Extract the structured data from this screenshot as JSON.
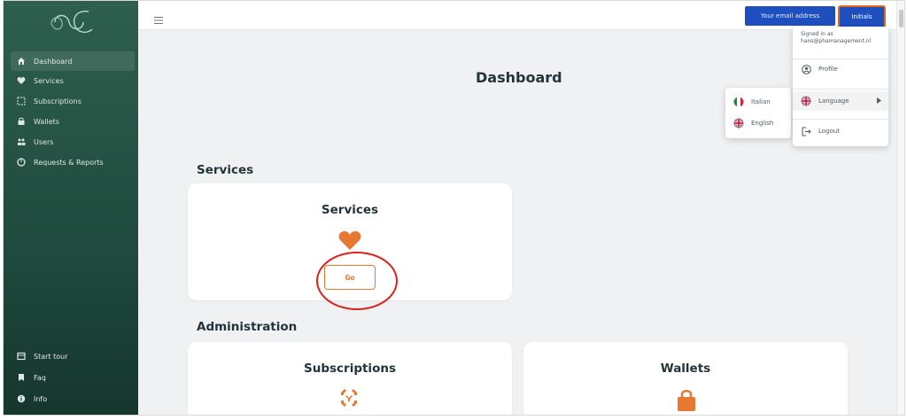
{
  "sidebar": {
    "items": [
      {
        "label": "Dashboard",
        "icon": "home-icon"
      },
      {
        "label": "Services",
        "icon": "heart-icon"
      },
      {
        "label": "Subscriptions",
        "icon": "subscriptions-icon"
      },
      {
        "label": "Wallets",
        "icon": "wallet-icon"
      },
      {
        "label": "Users",
        "icon": "users-icon"
      },
      {
        "label": "Requests & Reports",
        "icon": "report-icon"
      }
    ],
    "bottom_items": [
      {
        "label": "Start tour",
        "icon": "tour-icon"
      },
      {
        "label": "Faq",
        "icon": "bookmark-icon"
      },
      {
        "label": "Info",
        "icon": "info-icon"
      }
    ]
  },
  "topbar": {
    "email_button": "Your email address",
    "initials_button": "Initials"
  },
  "main": {
    "title": "Dashboard",
    "sections": [
      {
        "title": "Services"
      },
      {
        "title": "Administration"
      }
    ],
    "cards": {
      "services": {
        "title": "Services",
        "button": "Go"
      },
      "subscriptions": {
        "title": "Subscriptions"
      },
      "wallets": {
        "title": "Wallets"
      }
    }
  },
  "user_menu": {
    "signed_in_as": "Signed in as",
    "email": "hans@phamanagement.nl",
    "items": [
      {
        "label": "Profile",
        "icon": "profile-icon"
      },
      {
        "label": "Language",
        "icon": "uk-flag-icon"
      },
      {
        "label": "Logout",
        "icon": "logout-icon"
      }
    ]
  },
  "language_menu": {
    "items": [
      {
        "label": "Italian",
        "icon": "italy-flag-icon"
      },
      {
        "label": "English",
        "icon": "uk-flag-icon"
      }
    ]
  },
  "colors": {
    "accent_orange": "#e87731",
    "primary_blue": "#1f4fbf",
    "sidebar_green": "#2e5f4e",
    "annotation_red": "#e0211b"
  }
}
